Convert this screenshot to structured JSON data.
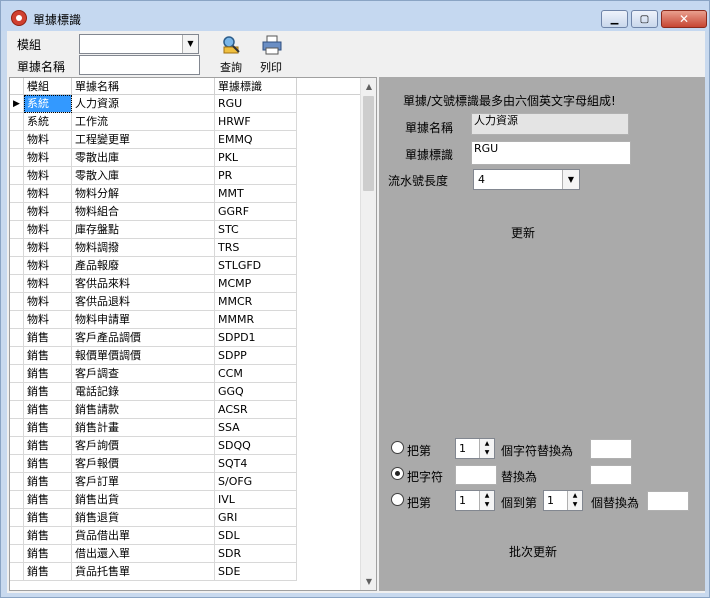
{
  "window": {
    "title": "單據標識",
    "min_icon": "minimize-icon",
    "max_icon": "maximize-icon",
    "close_icon": "close-icon"
  },
  "toolbar": {
    "module_label": "模組",
    "module_value": "",
    "doc_name_label": "單據名稱",
    "doc_name_value": "",
    "query_label": "查詢",
    "print_label": "列印"
  },
  "grid": {
    "columns": [
      "模組",
      "單據名稱",
      "單據標識"
    ],
    "rows": [
      [
        "系統",
        "人力資源",
        "RGU"
      ],
      [
        "系統",
        "工作流",
        "HRWF"
      ],
      [
        "物料",
        "工程變更單",
        "EMMQ"
      ],
      [
        "物料",
        "零散出庫",
        "PKL"
      ],
      [
        "物料",
        "零散入庫",
        "PR"
      ],
      [
        "物料",
        "物料分解",
        "MMT"
      ],
      [
        "物料",
        "物料組合",
        "GGRF"
      ],
      [
        "物料",
        "庫存盤點",
        "STC"
      ],
      [
        "物料",
        "物料調撥",
        "TRS"
      ],
      [
        "物料",
        "產品報廢",
        "STLGFD"
      ],
      [
        "物料",
        "客供品來料",
        "MCMP"
      ],
      [
        "物料",
        "客供品退料",
        "MMCR"
      ],
      [
        "物料",
        "物料申請單",
        "MMMR"
      ],
      [
        "銷售",
        "客戶產品調價",
        "SDPD1"
      ],
      [
        "銷售",
        "報價單價調價",
        "SDPP"
      ],
      [
        "銷售",
        "客戶調查",
        "CCM"
      ],
      [
        "銷售",
        "電話記錄",
        "GGQ"
      ],
      [
        "銷售",
        "銷售請款",
        "ACSR"
      ],
      [
        "銷售",
        "銷售計畫",
        "SSA"
      ],
      [
        "銷售",
        "客戶詢價",
        "SDQQ"
      ],
      [
        "銷售",
        "客戶報價",
        "SQT4"
      ],
      [
        "銷售",
        "客戶訂單",
        "S/OFG"
      ],
      [
        "銷售",
        "銷售出貨",
        "IVL"
      ],
      [
        "銷售",
        "銷售退貨",
        "GRI"
      ],
      [
        "銷售",
        "貨品借出單",
        "SDL"
      ],
      [
        "銷售",
        "借出還入單",
        "SDR"
      ],
      [
        "銷售",
        "貨品托售單",
        "SDE"
      ]
    ],
    "selected_indicator": "▶"
  },
  "panel": {
    "note": "單據/文號標識最多由六個英文字母組成!",
    "doc_name_label": "單據名稱",
    "doc_name_value": "人力資源",
    "doc_id_label": "單據標識",
    "doc_id_value": "RGU",
    "serial_len_label": "流水號長度",
    "serial_len_value": "4",
    "update_label": "更新",
    "batch": {
      "opt1_prefix": "把第",
      "opt1_spin": "1",
      "opt1_suffix": "個字符替換為",
      "opt2_prefix": "把字符",
      "opt2_middle": "替換為",
      "opt3_prefix": "把第",
      "opt3_spin1": "1",
      "opt3_middle": "個到第",
      "opt3_spin2": "1",
      "opt3_suffix": "個替換為",
      "selected_option": 2
    },
    "batch_update_label": "批次更新"
  }
}
